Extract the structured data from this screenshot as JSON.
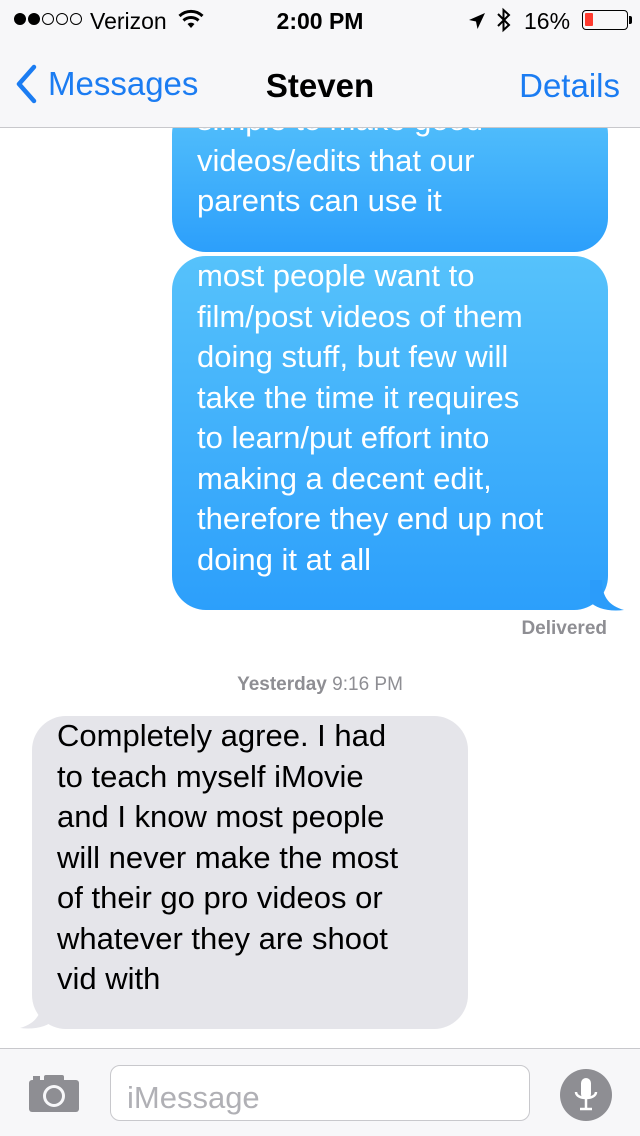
{
  "status_bar": {
    "carrier": "Verizon",
    "time": "2:00 PM",
    "battery_percent": "16%",
    "signal_bars_filled": 2,
    "signal_bars_total": 5,
    "battery_level": 0.16,
    "battery_color": "#ff3b30",
    "icons": [
      "wifi-icon",
      "location-arrow-icon",
      "bluetooth-icon",
      "battery-icon"
    ]
  },
  "nav": {
    "back_label": "Messages",
    "title": "Steven",
    "details_label": "Details",
    "accent_color": "#1b7cf2"
  },
  "messages": [
    {
      "direction": "outgoing",
      "lines": [
        "simple to make good",
        "videos/edits that our",
        "parents can use it"
      ]
    },
    {
      "direction": "outgoing",
      "lines": [
        "most people want to",
        "film/post videos of them",
        "doing stuff, but few will",
        "take the time it requires",
        "to learn/put effort into",
        "making a decent edit,",
        "therefore they end up not",
        "doing it at all"
      ]
    },
    {
      "direction": "incoming",
      "lines": [
        "Completely agree. I had",
        "to teach myself iMovie",
        "and I know most people",
        "will never make the most",
        "of their go pro videos or",
        "whatever they are shoot",
        "vid with"
      ]
    }
  ],
  "delivered_label": "Delivered",
  "timestamp": {
    "day": "Yesterday",
    "time": "9:16 PM"
  },
  "input_bar": {
    "placeholder": "iMessage",
    "camera_icon": "camera-icon",
    "mic_icon": "microphone-icon"
  }
}
